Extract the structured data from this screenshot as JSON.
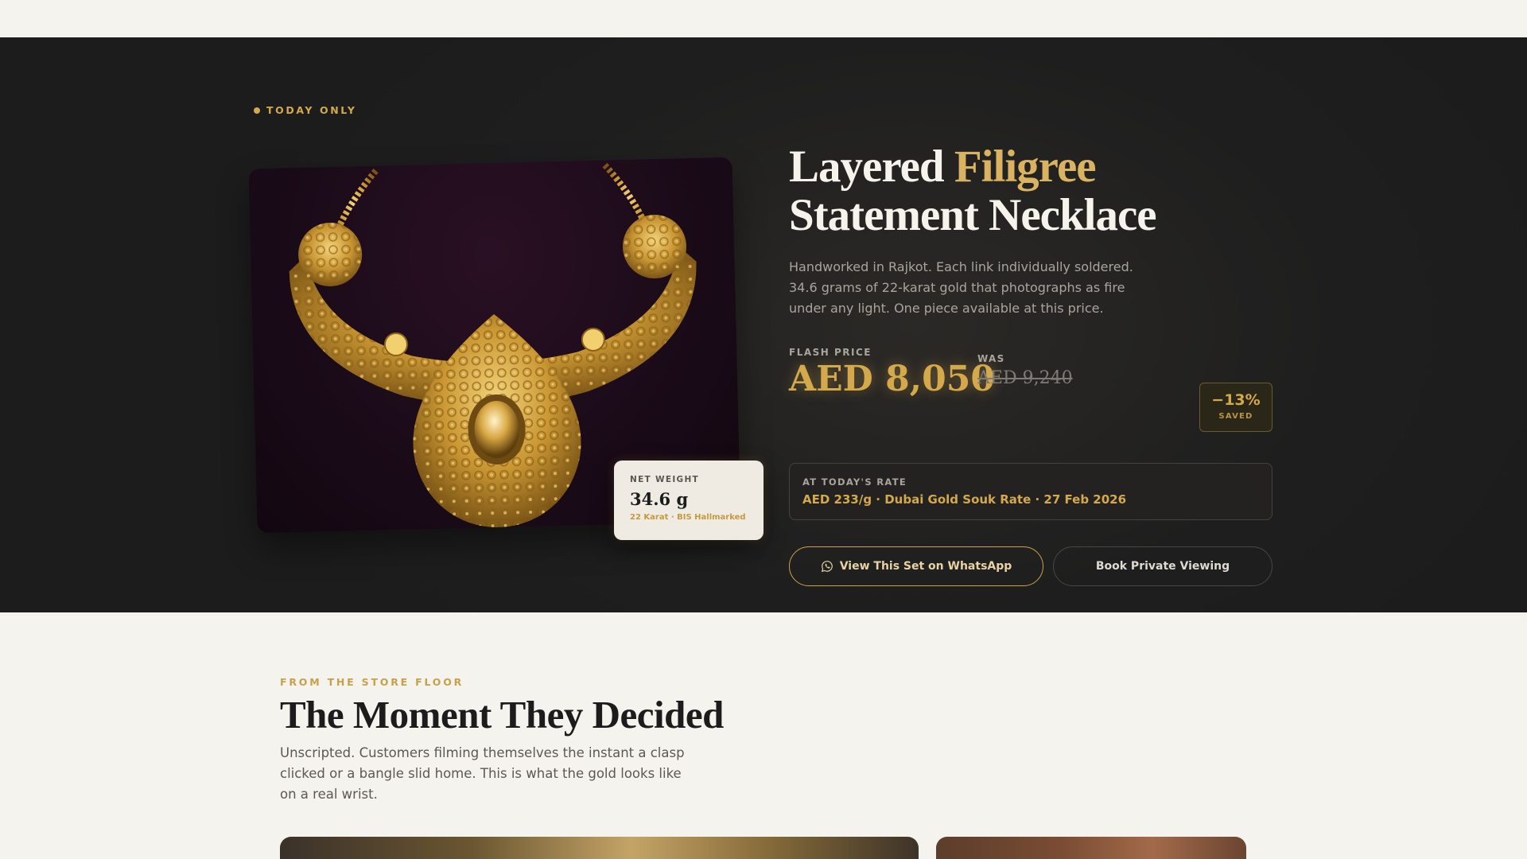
{
  "hero": {
    "badge": "TODAY ONLY",
    "title_part1": "Layered ",
    "title_highlight": "Filigree",
    "title_part2": "Statement Necklace",
    "description": "Handworked in Rajkot. Each link individually soldered. 34.6 grams of 22-karat gold that photographs as fire under any light. One piece available at this price.",
    "net_weight": {
      "label": "NET WEIGHT",
      "value": "34.6 g",
      "sub": "22 Karat · BIS Hallmarked"
    },
    "pricing": {
      "flash_label": "FLASH PRICE",
      "flash_price": "AED 8,050",
      "was_label": "WAS",
      "was_price": "AED 9,240",
      "discount": "−13%",
      "discount_label": "SAVED"
    },
    "rate": {
      "label": "AT TODAY'S RATE",
      "value": "AED 233/g · Dubai Gold Souk Rate · 27 Feb 2026"
    },
    "buttons": {
      "whatsapp": "View This Set on WhatsApp",
      "book": "Book Private Viewing"
    }
  },
  "section2": {
    "eyebrow": "FROM THE STORE FLOOR",
    "title": "The Moment They Decided",
    "description": "Unscripted. Customers filming themselves the instant a clasp clicked or a bangle slid home. This is what the gold looks like on a real wrist."
  },
  "colors": {
    "gold": "#d4a94b",
    "hero_bg": "#1e1e1e",
    "page_bg": "#f5f3ee"
  },
  "icons": {
    "whatsapp": "whatsapp-icon",
    "badge_dot": "dot-icon"
  }
}
